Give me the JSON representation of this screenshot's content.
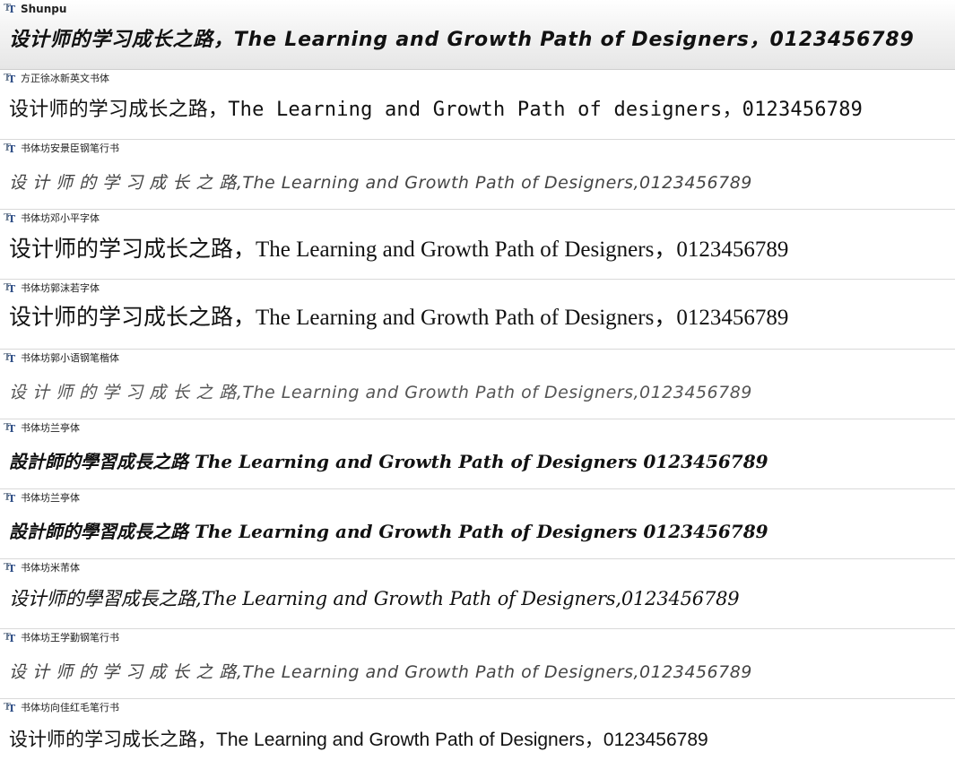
{
  "font_list": [
    {
      "name": "Shunpu",
      "sample": "设计师的学习成长之路，The Learning and Growth Path of Designers，0123456789",
      "selected": true
    },
    {
      "name": "方正徐冰新英文书体",
      "sample": "设计师的学习成长之路，The Learning and Growth Path of designers，0123456789",
      "selected": false
    },
    {
      "name": "书体坊安景臣钢笔行书",
      "sample": "设 计 师 的 学 习 成 长 之 路,The Learning and Growth Path of Designers,0123456789",
      "selected": false
    },
    {
      "name": "书体坊邓小平字体",
      "sample": "设计师的学习成长之路，The Learning and Growth Path of Designers，0123456789",
      "selected": false
    },
    {
      "name": "书体坊郭沫若字体",
      "sample": "设计师的学习成长之路，The Learning and Growth Path of Designers，0123456789",
      "selected": false
    },
    {
      "name": "书体坊郭小语钢笔楷体",
      "sample": "设 计 师 的 学 习 成 长 之 路,The Learning and Growth Path of Designers,0123456789",
      "selected": false
    },
    {
      "name": "书体坊兰亭体",
      "sample": "設計師的學習成長之路 The Learning and Growth Path of Designers 0123456789",
      "selected": false
    },
    {
      "name": "书体坊兰亭体",
      "sample": "設計師的學習成長之路 The Learning and Growth Path of Designers 0123456789",
      "selected": false
    },
    {
      "name": "书体坊米芾体",
      "sample": "设计师的學習成長之路,The Learning and Growth Path of Designers,0123456789",
      "selected": false
    },
    {
      "name": "书体坊王学勤钢笔行书",
      "sample": "设 计 师 的 学 习 成 长 之 路,The Learning and Growth Path of Designers,0123456789",
      "selected": false
    },
    {
      "name": "书体坊向佳红毛笔行书",
      "sample": "设计师的学习成长之路，The Learning and Growth Path of Designers，0123456789",
      "selected": false
    }
  ],
  "icons": {
    "font_type_icon": "truetype-font-icon"
  },
  "colors": {
    "row_border": "#d9d9d9",
    "selected_row_top": "#ffffff",
    "selected_row_bottom": "#e6e6e6",
    "icon_light": "#6f7f93",
    "icon_dark": "#2d4d86",
    "text": "#111111"
  }
}
